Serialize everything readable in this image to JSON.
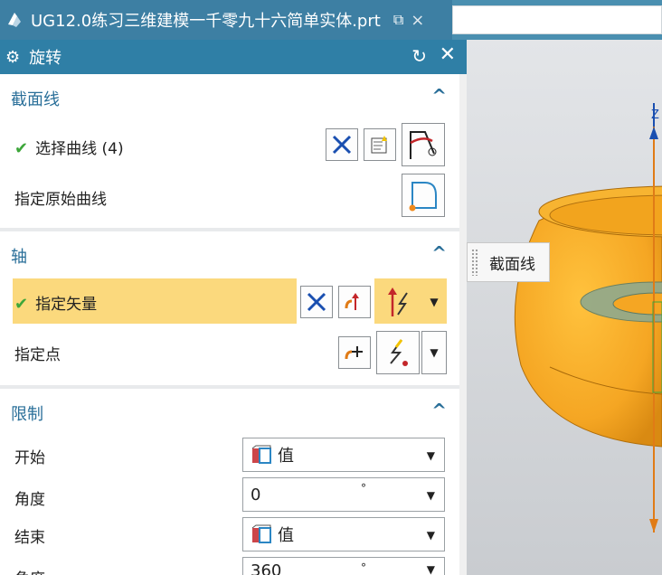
{
  "window": {
    "title": "UG12.0练习三维建模一千零九十六简单实体.prt",
    "popout_glyph": "⧉",
    "close_glyph": "×"
  },
  "dialog": {
    "title": "旋转",
    "gear_glyph": "⚙",
    "reset_glyph": "↻",
    "close_glyph": "✕"
  },
  "sections": {
    "section_curve": {
      "title": "截面线",
      "select_curve_label": "选择曲线 (4)",
      "origin_curve_label": "指定原始曲线"
    },
    "axis": {
      "title": "轴",
      "vector_label": "指定矢量",
      "point_label": "指定点"
    },
    "limits": {
      "title": "限制",
      "start_label": "开始",
      "start_mode": "值",
      "start_angle_label": "角度",
      "start_angle_value": "0",
      "end_label": "结束",
      "end_mode": "值",
      "end_angle_label": "角度",
      "end_angle_value": "360",
      "unit": "°"
    }
  },
  "icons": {
    "check": "✔",
    "chevron_up": "^",
    "dropdown": "▼"
  },
  "tooltip": {
    "text": "截面线"
  },
  "viewport": {
    "axis_label": "Z"
  },
  "colors": {
    "header": "#2f7fa6",
    "section_title": "#2a6f99",
    "highlight": "#fbd97d",
    "solid": "#f5a623"
  }
}
